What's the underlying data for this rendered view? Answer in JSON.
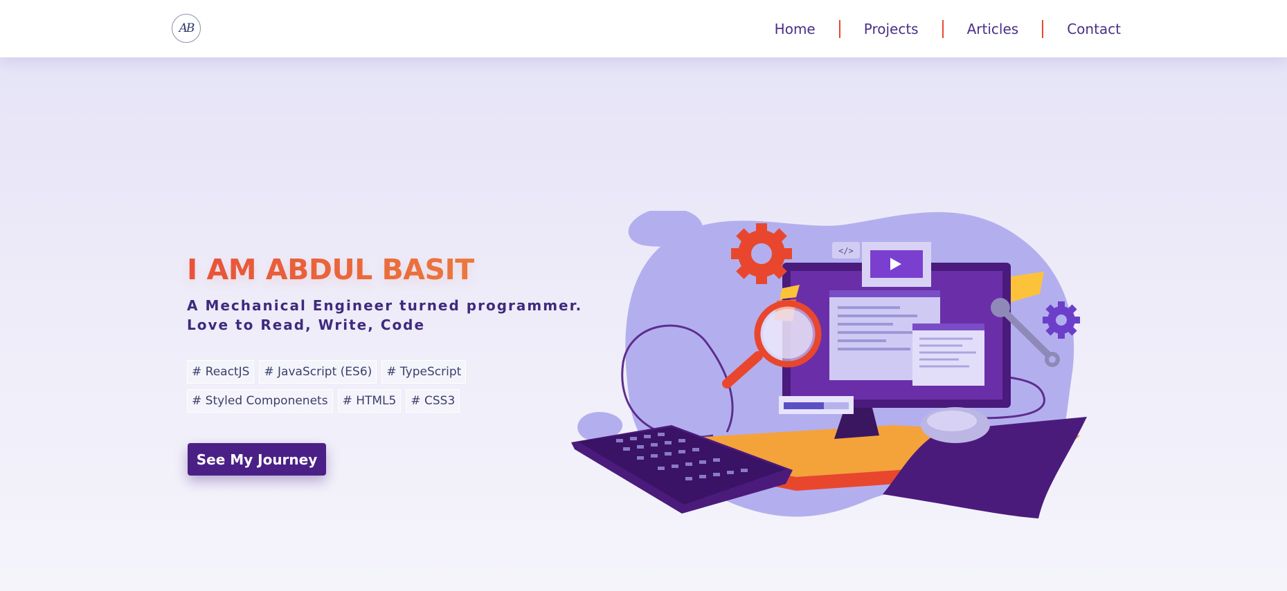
{
  "header": {
    "logo_text": "AB",
    "nav": [
      {
        "label": "Home"
      },
      {
        "label": "Projects"
      },
      {
        "label": "Articles"
      },
      {
        "label": "Contact"
      }
    ]
  },
  "hero": {
    "title": "I AM ABDUL BASIT",
    "tagline_line1": "A Mechanical Engineer turned programmer.",
    "tagline_line2": "Love to Read, Write, Code",
    "tags": [
      "# ReactJS",
      "# JavaScript (ES6)",
      "# TypeScript",
      "# Styled Componenets",
      "# HTML5",
      "# CSS3"
    ],
    "cta_label": "See My Journey"
  },
  "illustration": {
    "icon": "developer-workspace-illustration",
    "code_tag": "</>"
  },
  "colors": {
    "accent": "#e8472e",
    "primary": "#4b2086",
    "text": "#3f2a7d"
  }
}
